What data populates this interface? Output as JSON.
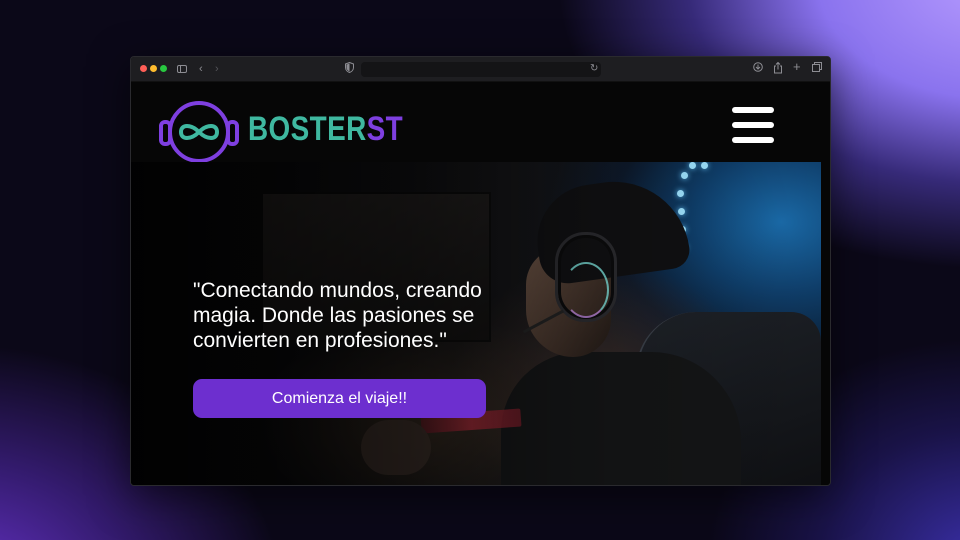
{
  "browser": {
    "address": "",
    "icons": {
      "sidebar": "sidebar-icon",
      "back": "chevron-left-icon",
      "forward": "chevron-right-icon",
      "shield": "shield-icon",
      "reload": "reload-icon",
      "download": "download-icon",
      "share": "share-icon",
      "new_tab": "plus-icon",
      "tabs": "tabs-overview-icon"
    }
  },
  "header": {
    "brand_part1": "BOSTER",
    "brand_part2": "ST",
    "menu_icon": "hamburger-menu-icon"
  },
  "hero": {
    "quote": "\"Conectando mundos, creando magia. Donde las pasiones se convierten en profesiones.\"",
    "cta_label": "Comienza el viaje!!"
  },
  "colors": {
    "brand_teal": "#3fb8a0",
    "brand_purple": "#7e3fe0",
    "cta_background": "#6d2fcf",
    "header_background": "#060606"
  }
}
